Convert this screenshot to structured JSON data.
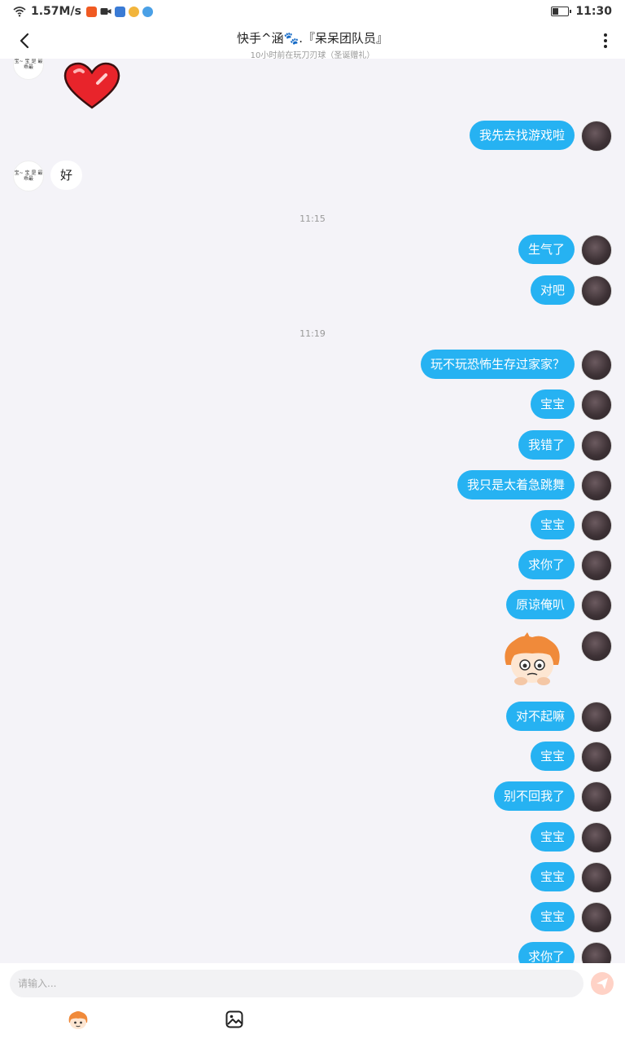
{
  "status_bar": {
    "net_speed": "1.57M/s",
    "time": "11:30"
  },
  "header": {
    "title": "快手^涵🐾.『呆呆团队员』",
    "subtitle": "10小时前在玩刀刃球（圣诞赠礼）"
  },
  "messages": {
    "m1": "我先去找游戏啦",
    "m2": "好",
    "t1": "11:15",
    "m3": "生气了",
    "m4": "对吧",
    "t2": "11:19",
    "m5": "玩不玩恐怖生存过家家？",
    "m6": "宝宝",
    "m7": "我错了",
    "m8": "我只是太着急跳舞",
    "m9": "宝宝",
    "m10": "求你了",
    "m11": "原谅俺叭",
    "m12": "对不起嘛",
    "m13": "宝宝",
    "m14": "别不回我了",
    "m15": "宝宝",
    "m16": "宝宝",
    "m17": "宝宝",
    "m18": "求你了"
  },
  "contact_avatar_text": "宝~ 宝\n是 最乖最",
  "input": {
    "placeholder": "请输入..."
  },
  "colors": {
    "outgoing_bubble": "#26b2f2",
    "chat_background": "#f4f3f8"
  },
  "icons": {
    "back": "chevron-left-icon",
    "more": "more-vertical-icon",
    "send": "send-icon",
    "emoji": "emoji-icon",
    "image": "image-icon"
  }
}
